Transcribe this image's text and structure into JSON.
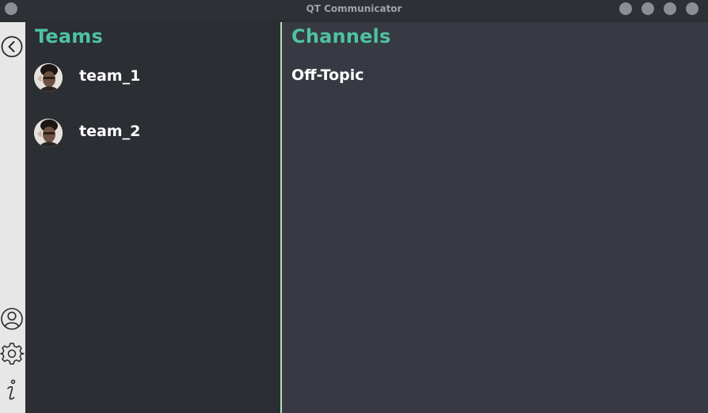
{
  "window": {
    "title": "QT Communicator",
    "controls": [
      "window-menu-icon",
      "minimize-icon",
      "maximize-icon",
      "restore-icon",
      "close-icon"
    ]
  },
  "rail": {
    "top_icons": [
      "back-icon"
    ],
    "bottom_icons": [
      "user-profile-icon",
      "settings-gear-icon",
      "info-icon"
    ]
  },
  "teams": {
    "heading": "Teams",
    "items": [
      {
        "label": "team_1",
        "avatar": "team-avatar"
      },
      {
        "label": "team_2",
        "avatar": "team-avatar"
      }
    ]
  },
  "channels": {
    "heading": "Channels",
    "items": [
      {
        "label": "Off-Topic"
      }
    ]
  },
  "colors": {
    "accent_heading": "#4ec3a1",
    "divider": "#a8e6b3",
    "teams_bg": "#2b2e33",
    "channels_bg": "#373a42",
    "rail_bg": "#e7e7e7",
    "item_text": "#ffffff"
  }
}
